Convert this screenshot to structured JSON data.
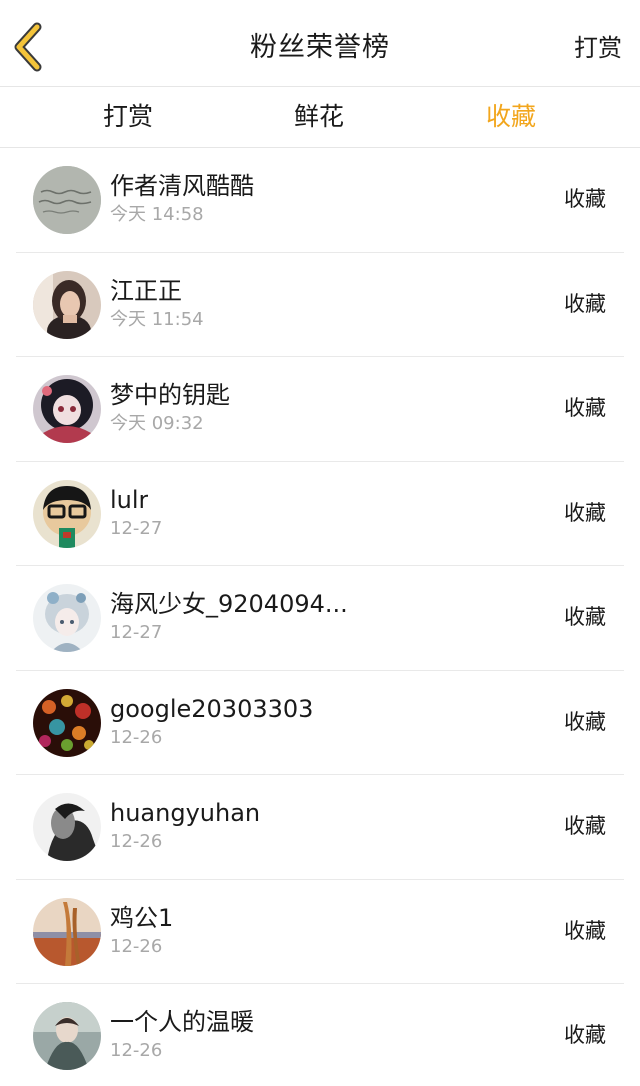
{
  "header": {
    "title": "粉丝荣誉榜",
    "action_label": "打赏"
  },
  "tabs": [
    {
      "label": "打赏",
      "active": false
    },
    {
      "label": "鲜花",
      "active": false
    },
    {
      "label": "收藏",
      "active": true
    }
  ],
  "colors": {
    "accent": "#f2a61d",
    "divider": "#e6e6e6",
    "muted_text": "#a8a8a8"
  },
  "items": [
    {
      "name": "作者清风酷酷",
      "time": "今天 14:58",
      "action": "收藏"
    },
    {
      "name": "江正正",
      "time": "今天 11:54",
      "action": "收藏"
    },
    {
      "name": "梦中的钥匙",
      "time": "今天 09:32",
      "action": "收藏"
    },
    {
      "name": "lulr",
      "time": "12-27",
      "action": "收藏"
    },
    {
      "name": "海风少女_9204094...",
      "time": "12-27",
      "action": "收藏"
    },
    {
      "name": "google20303303",
      "time": "12-26",
      "action": "收藏"
    },
    {
      "name": "huangyuhan",
      "time": "12-26",
      "action": "收藏"
    },
    {
      "name": "鸡公1",
      "time": "12-26",
      "action": "收藏"
    },
    {
      "name": "一个人的温暖",
      "time": "12-26",
      "action": "收藏"
    }
  ]
}
